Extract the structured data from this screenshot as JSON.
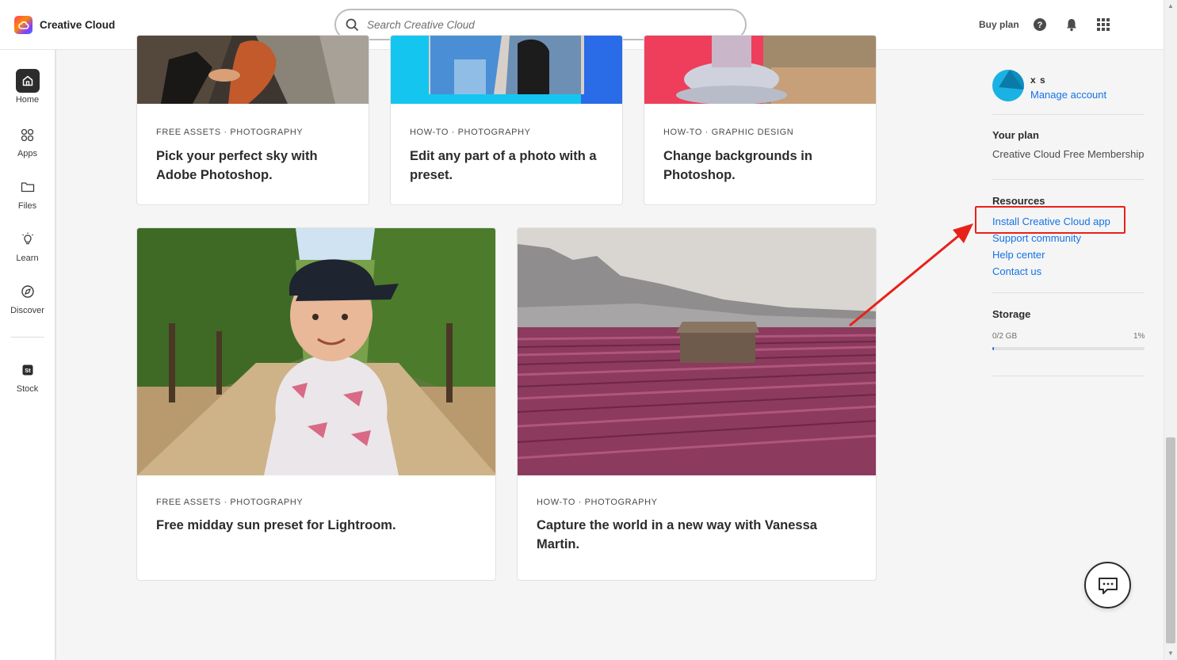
{
  "app": {
    "name": "Creative Cloud"
  },
  "search": {
    "placeholder": "Search Creative Cloud"
  },
  "header": {
    "buy_plan": "Buy plan",
    "icons": [
      "help-icon",
      "bell-icon",
      "apps-grid-icon"
    ]
  },
  "nav": {
    "items": [
      {
        "label": "Home",
        "icon": "home-icon",
        "active": true
      },
      {
        "label": "Apps",
        "icon": "apps-icon"
      },
      {
        "label": "Files",
        "icon": "folder-icon"
      },
      {
        "label": "Learn",
        "icon": "lightbulb-icon"
      },
      {
        "label": "Discover",
        "icon": "compass-icon"
      },
      {
        "label": "Stock",
        "icon": "stock-icon"
      }
    ]
  },
  "cards": [
    {
      "category": "FREE ASSETS · PHOTOGRAPHY",
      "title": "Pick your perfect sky with Adobe Photoshop."
    },
    {
      "category": "HOW-TO · PHOTOGRAPHY",
      "title": "Edit any part of a photo with a preset."
    },
    {
      "category": "HOW-TO · GRAPHIC DESIGN",
      "title": "Change backgrounds in Photoshop."
    },
    {
      "category": "FREE ASSETS · PHOTOGRAPHY",
      "title": "Free midday sun preset for Lightroom."
    },
    {
      "category": "HOW-TO · PHOTOGRAPHY",
      "title": "Capture the world in a new way with Vanessa Martin."
    }
  ],
  "account": {
    "name": "x s",
    "manage_link": "Manage account",
    "plan_heading": "Your plan",
    "plan_name": "Creative Cloud Free Membership"
  },
  "resources": {
    "heading": "Resources",
    "links": [
      "Install Creative Cloud app",
      "Support community",
      "Help center",
      "Contact us"
    ]
  },
  "storage": {
    "heading": "Storage",
    "used": "0/2 GB",
    "percent_label": "1%",
    "percent": 1
  },
  "colors": {
    "link": "#1473e6",
    "annotation": "#e8211a",
    "avatar": "#1ab2e3"
  }
}
